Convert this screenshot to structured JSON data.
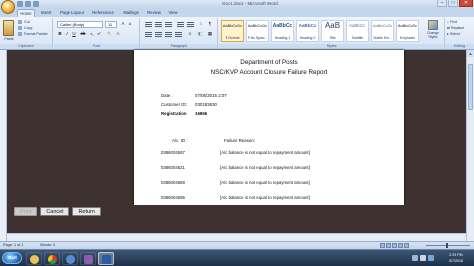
{
  "window": {
    "title": "Doc1.docx - Microsoft Word"
  },
  "tabs": [
    "Home",
    "Insert",
    "Page Layout",
    "References",
    "Mailings",
    "Review",
    "View"
  ],
  "ribbon": {
    "clipboard": {
      "paste_label": "Paste",
      "cut_label": "Cut",
      "copy_label": "Copy",
      "format_painter_label": "Format Painter",
      "group_label": "Clipboard"
    },
    "font": {
      "font_name": "Calibri (Body)",
      "font_size": "11",
      "group_label": "Font"
    },
    "paragraph": {
      "group_label": "Paragraph"
    },
    "styles": {
      "items": [
        {
          "sample": "AaBbCcDc",
          "name": "¶ Normal"
        },
        {
          "sample": "AaBbCcDc",
          "name": "¶ No Spaci..."
        },
        {
          "sample": "AaBbCc",
          "name": "Heading 1"
        },
        {
          "sample": "AaBbCc",
          "name": "Heading 2"
        },
        {
          "sample": "AaB",
          "name": "Title"
        },
        {
          "sample": "AaBbCc.",
          "name": "Subtitle"
        },
        {
          "sample": "AaBbCcDc",
          "name": "Subtle Em..."
        },
        {
          "sample": "AaBbCcDc",
          "name": "Emphasis"
        }
      ],
      "change_styles_label": "Change Styles",
      "group_label": "Styles"
    },
    "editing": {
      "find_label": "Find",
      "replace_label": "Replace",
      "select_label": "Select",
      "group_label": "Editing"
    }
  },
  "report": {
    "title_line1": "Department of Posts",
    "title_line2": "NSC/KVP Account Closure Failure Report",
    "date_label": "Date :",
    "date_value": "07/05/2015 2:07",
    "customer_id_label": "Customer  ID:",
    "customer_id_value": "030183630",
    "registration_label": "Registration",
    "registration_value": "16866",
    "col_ac_id": "A/c. ID :",
    "col_failure_reason": "Failure Reason:",
    "rows": [
      {
        "ac_id": "0386004597",
        "reason": "[A/c balance is not equal to repayment amount]"
      },
      {
        "ac_id": "0386004621",
        "reason": "[A/c balance is not equal to repayment amount]"
      },
      {
        "ac_id": "0386004658",
        "reason": "[A/c balance is not equal to repayment amount]"
      },
      {
        "ac_id": "0386004695",
        "reason": "[A/c balance is not equal to repayment amount]"
      }
    ]
  },
  "form_buttons": {
    "print_label": "Print",
    "cancel_label": "Cancel",
    "return_label": "Return"
  },
  "statusbar": {
    "page_info": "Page: 1 of 1",
    "word_count": "Words: 0"
  },
  "taskbar": {
    "start_label": "Start",
    "clock_time": "2:29 PM",
    "clock_date": "5/7/2015"
  },
  "colors": {
    "workspace_bg": "#3d3230",
    "ribbon_bg": "#dfe9f6",
    "taskbar_bg": "#2a3f5a"
  }
}
